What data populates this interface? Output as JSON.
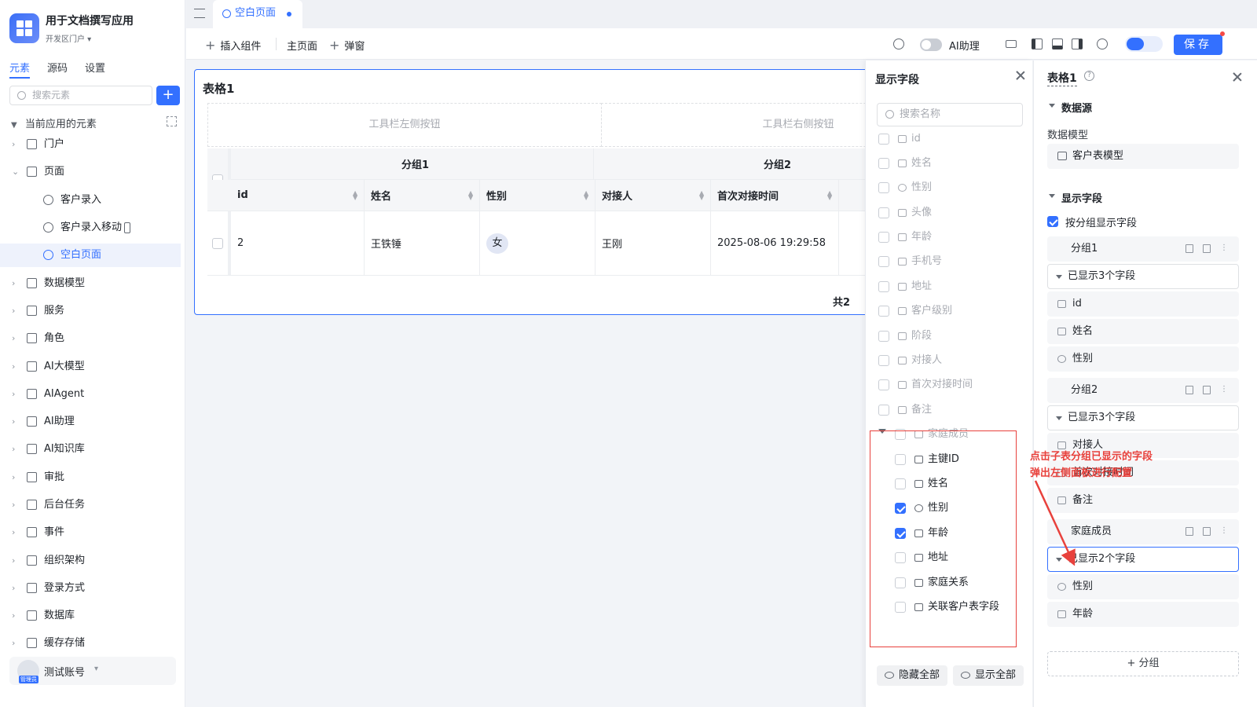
{
  "app": {
    "title": "用于文档撰写应用",
    "portal": "开发区门户 ▾"
  },
  "sidebar": {
    "tabs": [
      "元素",
      "源码",
      "设置"
    ],
    "search_placeholder": "搜索元素",
    "tree_header": "当前应用的元素",
    "items": [
      {
        "label": "门户",
        "icon": "home-icon"
      },
      {
        "label": "页面",
        "icon": "page-icon"
      },
      {
        "label": "客户录入",
        "icon": "page-item-icon"
      },
      {
        "label": "客户录入移动",
        "icon": "mobile-page-icon"
      },
      {
        "label": "空白页面",
        "icon": "page-item-icon"
      },
      {
        "label": "数据模型",
        "icon": "table-icon"
      },
      {
        "label": "服务",
        "icon": "service-icon"
      },
      {
        "label": "角色",
        "icon": "role-icon"
      },
      {
        "label": "AI大模型",
        "icon": "ai-model-icon"
      },
      {
        "label": "AIAgent",
        "icon": "robot-icon"
      },
      {
        "label": "AI助理",
        "icon": "ai-assistant-icon"
      },
      {
        "label": "AI知识库",
        "icon": "book-icon"
      },
      {
        "label": "审批",
        "icon": "stamp-icon"
      },
      {
        "label": "后台任务",
        "icon": "task-icon"
      },
      {
        "label": "事件",
        "icon": "event-icon"
      },
      {
        "label": "组织架构",
        "icon": "org-icon"
      },
      {
        "label": "登录方式",
        "icon": "login-icon"
      },
      {
        "label": "数据库",
        "icon": "database-icon"
      },
      {
        "label": "缓存存储",
        "icon": "cache-icon"
      }
    ],
    "user": {
      "name": "测试账号",
      "badge": "管理员"
    }
  },
  "tabbar": {
    "active_tab": "空白页面"
  },
  "toolbar": {
    "insert": "插入组件",
    "main_page": "主页面",
    "popup": "弹窗",
    "ai_assistant": "AI助理",
    "save": "保存"
  },
  "table": {
    "title": "表格1",
    "toolbar_left": "工具栏左侧按钮",
    "toolbar_right": "工具栏右侧按钮",
    "groups": [
      "分组1",
      "分组2"
    ],
    "columns": [
      "id",
      "姓名",
      "性别",
      "对接人",
      "首次对接时间"
    ],
    "rows": [
      {
        "id": "2",
        "name": "王铁锤",
        "gender": "女",
        "contact": "王刚",
        "first_time": "2025-08-06 19:29:58"
      }
    ],
    "total_prefix": "共2"
  },
  "field_panel": {
    "title": "显示字段",
    "search_placeholder": "搜索名称",
    "fields": [
      "id",
      "姓名",
      "性别",
      "头像",
      "年龄",
      "手机号",
      "地址",
      "客户级别",
      "阶段",
      "对接人",
      "首次对接时间",
      "备注"
    ],
    "subtable": {
      "name": "家庭成员",
      "fields": [
        {
          "label": "主键ID",
          "checked": false
        },
        {
          "label": "姓名",
          "checked": false
        },
        {
          "label": "性别",
          "checked": true
        },
        {
          "label": "年龄",
          "checked": true
        },
        {
          "label": "地址",
          "checked": false
        },
        {
          "label": "家庭关系",
          "checked": false
        },
        {
          "label": "关联客户表字段",
          "checked": false
        }
      ]
    },
    "hide_all": "隐藏全部",
    "show_all": "显示全部"
  },
  "props": {
    "title": "表格1",
    "datasource_section": "数据源",
    "data_model_label": "数据模型",
    "data_model_value": "客户表模型",
    "fields_section": "显示字段",
    "group_by_label": "按分组显示字段",
    "group1": {
      "name": "分组1",
      "shown": "已显示3个字段",
      "fields": [
        "id",
        "姓名",
        "性别"
      ]
    },
    "group2": {
      "name": "分组2",
      "shown": "已显示3个字段",
      "fields": [
        "对接人",
        "首次对接时间",
        "备注"
      ]
    },
    "group3": {
      "name": "家庭成员",
      "shown": "已显示2个字段",
      "fields": [
        "性别",
        "年龄"
      ]
    },
    "add_group": "+ 分组"
  },
  "annotation": {
    "line1": "点击子表分组已显示的字段",
    "line2": "弹出左侧面板进行配置"
  },
  "colors": {
    "accent": "#3370ff",
    "annotation": "#e8413c"
  }
}
